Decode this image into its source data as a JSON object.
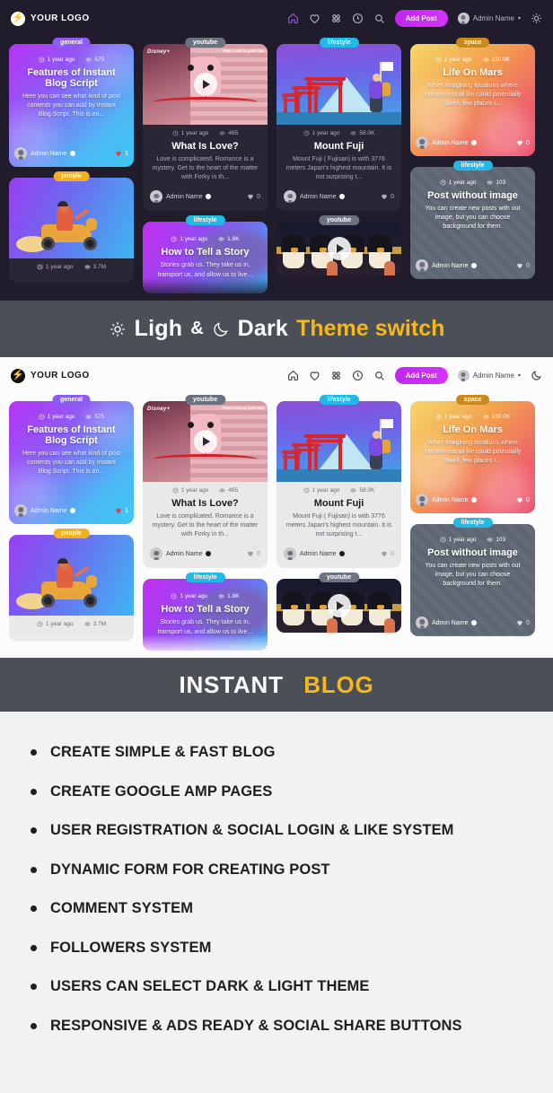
{
  "navbar": {
    "logo_text": "YOUR LOGO",
    "logo_icon": "lightning-bolt-icon",
    "icons": [
      "home-icon",
      "heart-icon",
      "grid-icon",
      "clock-icon",
      "search-icon"
    ],
    "add_post_label": "Add Post",
    "user_name": "Admin Name",
    "caret": "▾",
    "theme_toggle_dark": "sun-icon",
    "theme_toggle_light": "moon-icon"
  },
  "theme_banner": {
    "sun_icon": "sun-icon",
    "light_word": "Ligh",
    "amp": "&",
    "moon_icon": "moon-icon",
    "dark_word": "Dark",
    "accent_word": "Theme switch"
  },
  "title_banner": {
    "main": "INSTANT",
    "accent": "BLOG"
  },
  "colors": {
    "dark_bg": "#201c2b",
    "light_bg": "#fcfcfc",
    "banner_bg": "#4b4f57",
    "accent_yellow": "#f5b81c",
    "accent_purple": "#c026f0",
    "features_bg": "#f2f2f2"
  },
  "cards": {
    "general": {
      "category": "general",
      "time": "1 year ago",
      "views": "575",
      "title": "Features of Instant Blog Script",
      "desc": "Here you can see what kind of post contents you can add by Instant Blog Script. This is an...",
      "author": "Admin Name",
      "likes": "1"
    },
    "youtube_love": {
      "category": "youtube",
      "time": "1 year ago",
      "views": "465",
      "title": "What Is Love?",
      "desc": "Love is complicated. Romance is a mystery. Get to the heart of the matter with Forky in th...",
      "author": "Admin Name",
      "likes": "0",
      "thumb_brand": "Disney+",
      "thumb_brand_sub": "ORIGINAL",
      "thumb_tag": "FORKY ASKS A QUESTION"
    },
    "fuji": {
      "category": "lifestyle",
      "time": "1 year ago",
      "views": "58.0K",
      "title": "Mount Fuji",
      "desc": "Mount Fuji ( Fujisan) is with 3776 meters Japan's highest mountain. It is not surprising t...",
      "author": "Admin Name",
      "likes": "0"
    },
    "mars": {
      "category": "space",
      "time": "1 year ago",
      "views": "130.0K",
      "title": "Life On Mars",
      "desc": "When imagining locations where extraterrestrial life could potentially dwell, few places i...",
      "author": "Admin Name",
      "likes": "0"
    },
    "no_image": {
      "category": "lifestyle",
      "time": "1 year ago",
      "views": "103",
      "title": "Post without image",
      "desc": "You can create new posts with out image, but you can choose background for them.",
      "author": "Admin Name",
      "likes": "0"
    },
    "people": {
      "category": "people",
      "time": "1 year ago",
      "views": "3.7M"
    },
    "story": {
      "category": "lifestyle",
      "time": "1 year ago",
      "views": "1.8K",
      "title": "How to Tell a Story",
      "desc": "Stories grab us. They take us in, transport us, and allow us to live..."
    },
    "penguins": {
      "category": "youtube"
    }
  },
  "features": {
    "items": [
      "CREATE SIMPLE & FAST BLOG",
      "CREATE GOOGLE AMP PAGES",
      "USER REGISTRATION & SOCIAL LOGIN & LIKE SYSTEM",
      "DYNAMIC FORM FOR CREATING POST",
      "COMMENT SYSTEM",
      "FOLLOWERS SYSTEM",
      "USERS CAN SELECT DARK & LIGHT THEME",
      "RESPONSIVE & ADS READY & SOCIAL SHARE BUTTONS"
    ]
  }
}
